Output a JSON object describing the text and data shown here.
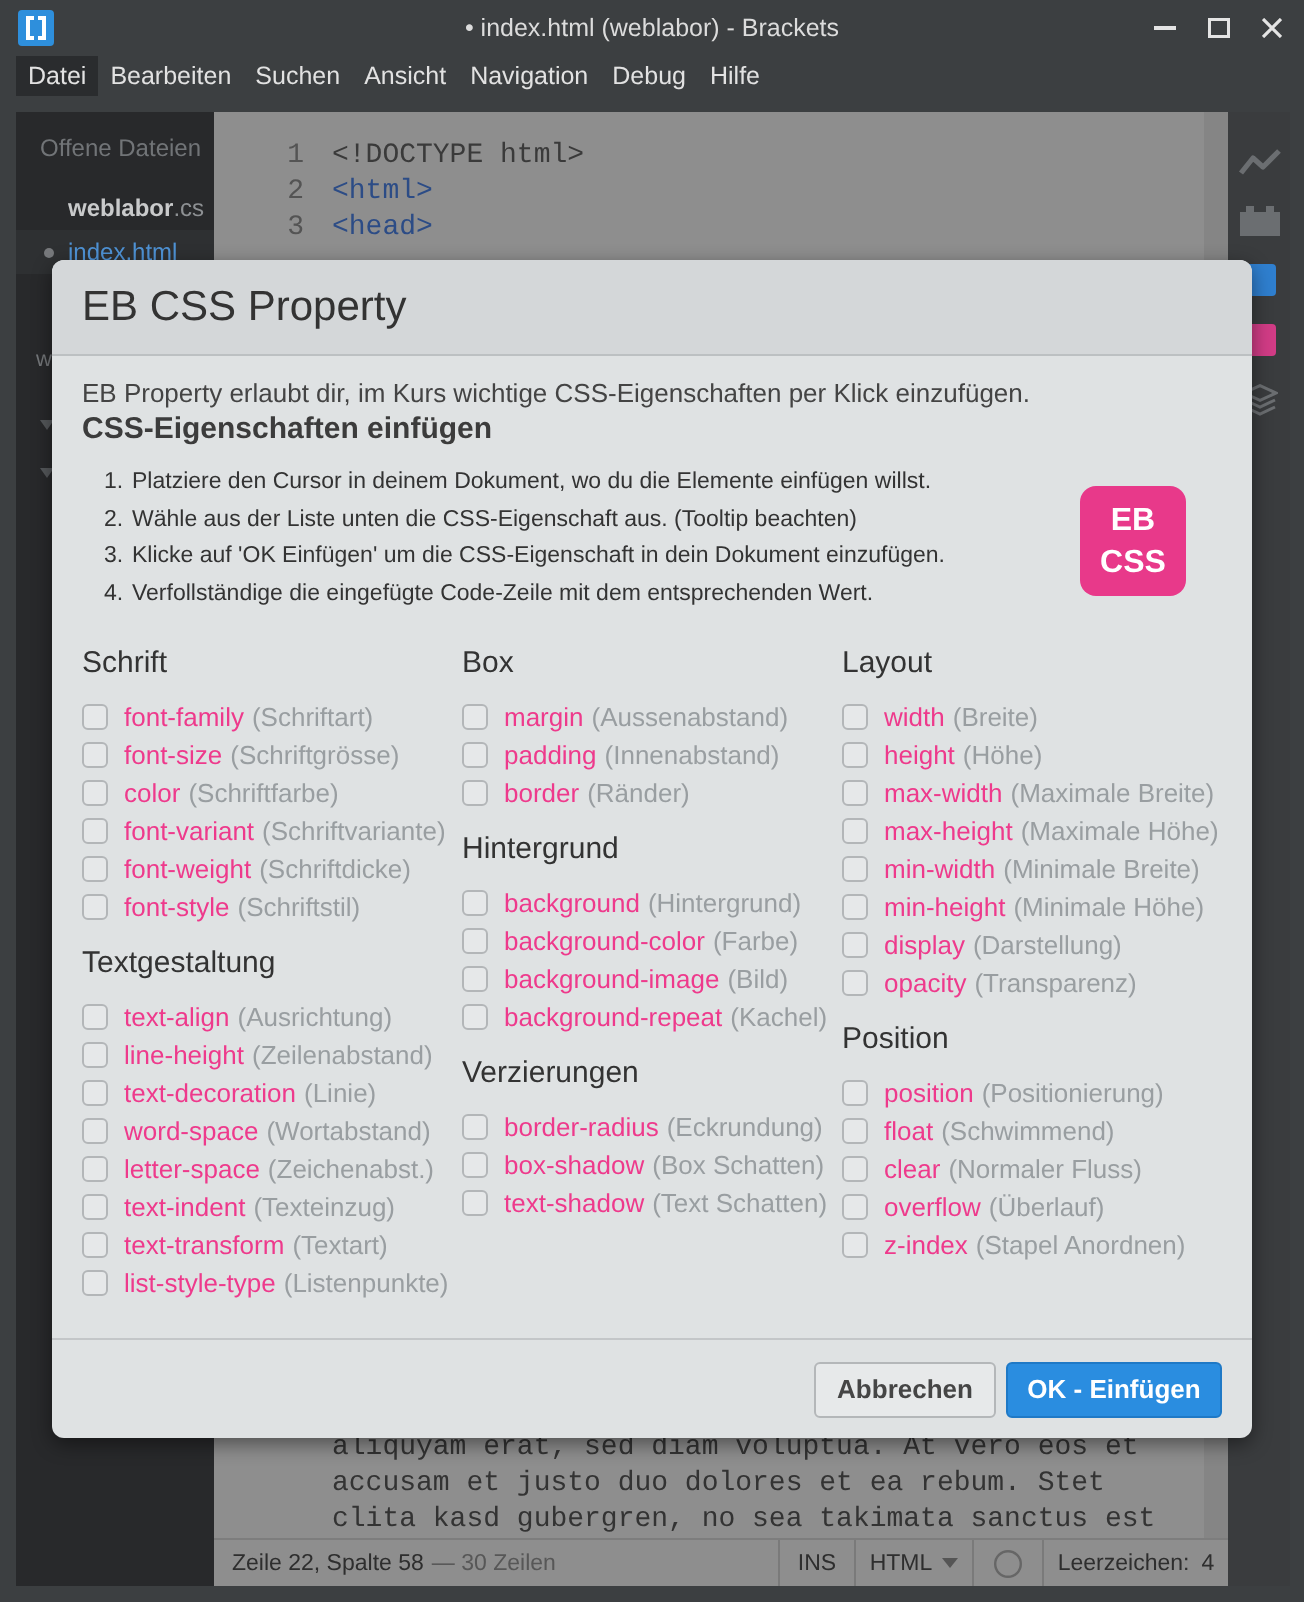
{
  "window": {
    "title": "• index.html (weblabor) - Brackets"
  },
  "menu": [
    {
      "label": "Datei",
      "selected": true
    },
    {
      "label": "Bearbeiten",
      "selected": false
    },
    {
      "label": "Suchen",
      "selected": false
    },
    {
      "label": "Ansicht",
      "selected": false
    },
    {
      "label": "Navigation",
      "selected": false
    },
    {
      "label": "Debug",
      "selected": false
    },
    {
      "label": "Hilfe",
      "selected": false
    }
  ],
  "sidebar": {
    "heading": "Offene Dateien",
    "files": [
      {
        "label": "**weblabor**.cs",
        "selected": false,
        "modified": false
      },
      {
        "label": "index.html",
        "selected": true,
        "modified": true
      }
    ],
    "project": "w"
  },
  "editor": {
    "top_lines": [
      {
        "number": "1",
        "tokens": [
          {
            "kind": "doctype",
            "text": "<!DOCTYPE html>"
          }
        ]
      },
      {
        "number": "2",
        "tokens": [
          {
            "kind": "tag",
            "text": "<html>"
          }
        ]
      },
      {
        "number": "3",
        "tokens": [
          {
            "kind": "tag",
            "text": "<head>"
          }
        ]
      }
    ],
    "bottom_lines": [
      "aliquyam erat, sed diam voluptua. At vero eos et",
      "accusam et justo duo dolores et ea rebum. Stet",
      "clita kasd gubergren, no sea takimata sanctus est"
    ]
  },
  "status_bar": {
    "position": "Zeile 22, Spalte 58",
    "line_count": "— 30 Zeilen",
    "mode": "INS",
    "language": "HTML",
    "indent_label": "Leerzeichen:",
    "indent_value": "4"
  },
  "dialog": {
    "title": "EB CSS Property",
    "intro": "EB Property erlaubt dir, im Kurs wichtige CSS-Eigenschaften per Klick einzufügen.",
    "subheading": "CSS-Eigenschaften einfügen",
    "steps": [
      {
        "number": "1.",
        "text": "Platziere den Cursor in deinem Dokument, wo du die Elemente einfügen willst."
      },
      {
        "number": "2.",
        "text": "Wähle aus der Liste unten die CSS-Eigenschaft aus. (Tooltip beachten)"
      },
      {
        "number": "3.",
        "text": "Klicke auf 'OK Einfügen' um die CSS-Eigenschaft in dein Dokument einzufügen."
      },
      {
        "number": "4.",
        "text": "Verfollständige die eingefügte Code-Zeile mit dem entsprechenden Wert."
      }
    ],
    "badge": "EB CSS",
    "columns": [
      {
        "sections": [
          {
            "heading": "Schrift",
            "items": [
              {
                "property": "font-family",
                "hint": "(Schriftart)",
                "checked": false
              },
              {
                "property": "font-size",
                "hint": "(Schriftgrösse)",
                "checked": false
              },
              {
                "property": "color",
                "hint": "(Schriftfarbe)",
                "checked": false
              },
              {
                "property": "font-variant",
                "hint": "(Schriftvariante)",
                "checked": false
              },
              {
                "property": "font-weight",
                "hint": "(Schriftdicke)",
                "checked": false
              },
              {
                "property": "font-style",
                "hint": "(Schriftstil)",
                "checked": false
              }
            ]
          },
          {
            "heading": "Textgestaltung",
            "items": [
              {
                "property": "text-align",
                "hint": "(Ausrichtung)",
                "checked": false
              },
              {
                "property": "line-height",
                "hint": "(Zeilenabstand)",
                "checked": false
              },
              {
                "property": "text-decoration",
                "hint": "(Linie)",
                "checked": false
              },
              {
                "property": "word-space",
                "hint": "(Wortabstand)",
                "checked": false
              },
              {
                "property": "letter-space",
                "hint": "(Zeichenabst.)",
                "checked": false
              },
              {
                "property": "text-indent",
                "hint": "(Texteinzug)",
                "checked": false
              },
              {
                "property": "text-transform",
                "hint": "(Textart)",
                "checked": false
              },
              {
                "property": "list-style-type",
                "hint": "(Listenpunkte)",
                "checked": false
              }
            ]
          }
        ]
      },
      {
        "sections": [
          {
            "heading": "Box",
            "items": [
              {
                "property": "margin",
                "hint": "(Aussenabstand)",
                "checked": false
              },
              {
                "property": "padding",
                "hint": "(Innenabstand)",
                "checked": false
              },
              {
                "property": "border",
                "hint": "(Ränder)",
                "checked": false
              }
            ]
          },
          {
            "heading": "Hintergrund",
            "items": [
              {
                "property": "background",
                "hint": "(Hintergrund)",
                "checked": false
              },
              {
                "property": "background-color",
                "hint": "(Farbe)",
                "checked": false
              },
              {
                "property": "background-image",
                "hint": "(Bild)",
                "checked": false
              },
              {
                "property": "background-repeat",
                "hint": "(Kachel)",
                "checked": false
              }
            ]
          },
          {
            "heading": "Verzierungen",
            "items": [
              {
                "property": "border-radius",
                "hint": "(Eckrundung)",
                "checked": false
              },
              {
                "property": "box-shadow",
                "hint": "(Box Schatten)",
                "checked": false
              },
              {
                "property": "text-shadow",
                "hint": "(Text Schatten)",
                "checked": false
              }
            ]
          }
        ]
      },
      {
        "sections": [
          {
            "heading": "Layout",
            "items": [
              {
                "property": "width",
                "hint": "(Breite)",
                "checked": false
              },
              {
                "property": "height",
                "hint": "(Höhe)",
                "checked": false
              },
              {
                "property": "max-width",
                "hint": "(Maximale Breite)",
                "checked": false
              },
              {
                "property": "max-height",
                "hint": "(Maximale Höhe)",
                "checked": false
              },
              {
                "property": "min-width",
                "hint": "(Minimale Breite)",
                "checked": false
              },
              {
                "property": "min-height",
                "hint": "(Minimale Höhe)",
                "checked": false
              },
              {
                "property": "display",
                "hint": "(Darstellung)",
                "checked": false
              },
              {
                "property": "opacity",
                "hint": "(Transparenz)",
                "checked": false
              }
            ]
          },
          {
            "heading": "Position",
            "items": [
              {
                "property": "position",
                "hint": "(Positionierung)",
                "checked": false
              },
              {
                "property": "float",
                "hint": "(Schwimmend)",
                "checked": false
              },
              {
                "property": "clear",
                "hint": "(Normaler Fluss)",
                "checked": false
              },
              {
                "property": "overflow",
                "hint": "(Überlauf)",
                "checked": false
              },
              {
                "property": "z-index",
                "hint": "(Stapel Anordnen)",
                "checked": false
              }
            ]
          }
        ]
      }
    ],
    "buttons": [
      {
        "label": "Abbrechen",
        "kind": "secondary"
      },
      {
        "label": "OK - Einfügen",
        "kind": "primary"
      }
    ]
  }
}
